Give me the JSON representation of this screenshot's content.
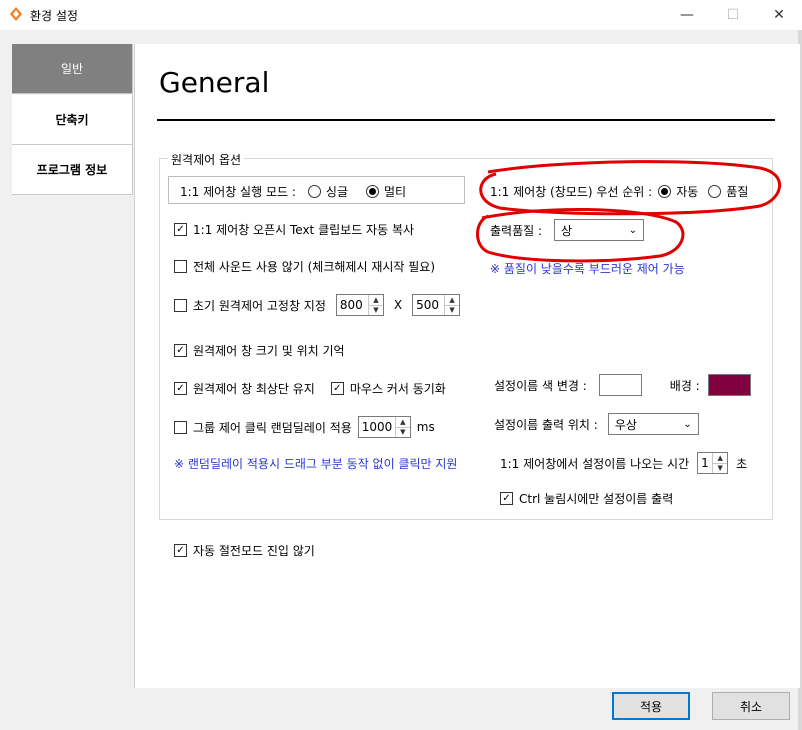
{
  "window": {
    "title": "환경 설정"
  },
  "sidebar": {
    "items": [
      {
        "label": "일반",
        "active": true
      },
      {
        "label": "단축키",
        "active": false
      },
      {
        "label": "프로그램 정보",
        "active": false
      }
    ]
  },
  "main": {
    "title": "General",
    "group_label": "원격제어 옵션",
    "mode": {
      "label": "1:1 제어창 실행 모드 :",
      "options": [
        "싱글",
        "멀티"
      ],
      "selected": "멀티"
    },
    "priority": {
      "label": "1:1 제어창 (창모드) 우선 순위 :",
      "options": [
        "자동",
        "품질"
      ],
      "selected": "자동"
    },
    "clipboard_copy": {
      "label": "1:1 제어창 오픈시 Text 클립보드 자동 복사",
      "checked": true
    },
    "quality": {
      "label": "출력품질 :",
      "value": "상",
      "note": "※ 품질이 낮을수록 부드러운 제어 가능"
    },
    "no_sound": {
      "label": "전체 사운드 사용 않기 (체크해제시 재시작 필요)",
      "checked": false
    },
    "fixed_size": {
      "label": "초기 원격제어 고정창 지정",
      "checked": false,
      "width": "800",
      "separator": "X",
      "height": "500"
    },
    "remember_pos": {
      "label": "원격제어 창 크기 및 위치 기억",
      "checked": true
    },
    "always_top": {
      "label": "원격제어 창 최상단 유지",
      "checked": true
    },
    "mouse_sync": {
      "label": "마우스 커서 동기화",
      "checked": true
    },
    "group_click": {
      "label": "그룹 제어 클릭 랜덤딜레이 적용",
      "checked": false,
      "value": "1000",
      "unit": "ms"
    },
    "group_note": "※ 랜덤딜레이 적용시 드래그 부분 동작 없이 클릭만 지원",
    "name_color": {
      "label": "설정이름 색 변경 :",
      "bg_label": "배경 :",
      "text_color": "#ffffff",
      "bg_color": "#800040"
    },
    "name_position": {
      "label": "설정이름 출력 위치 :",
      "value": "우상"
    },
    "name_time": {
      "label": "1:1 제어창에서 설정이름 나오는 시간",
      "value": "1",
      "unit": "초"
    },
    "ctrl_only": {
      "label": "Ctrl 눌림시에만 설정이름 출력",
      "checked": true
    },
    "no_power_save": {
      "label": "자동 절전모드 진입 않기",
      "checked": true
    }
  },
  "buttons": {
    "apply": "적용",
    "cancel": "취소"
  },
  "colors": {
    "accent": "#0078d7",
    "annotation": "#e00000",
    "note_blue": "#2a36d0"
  }
}
